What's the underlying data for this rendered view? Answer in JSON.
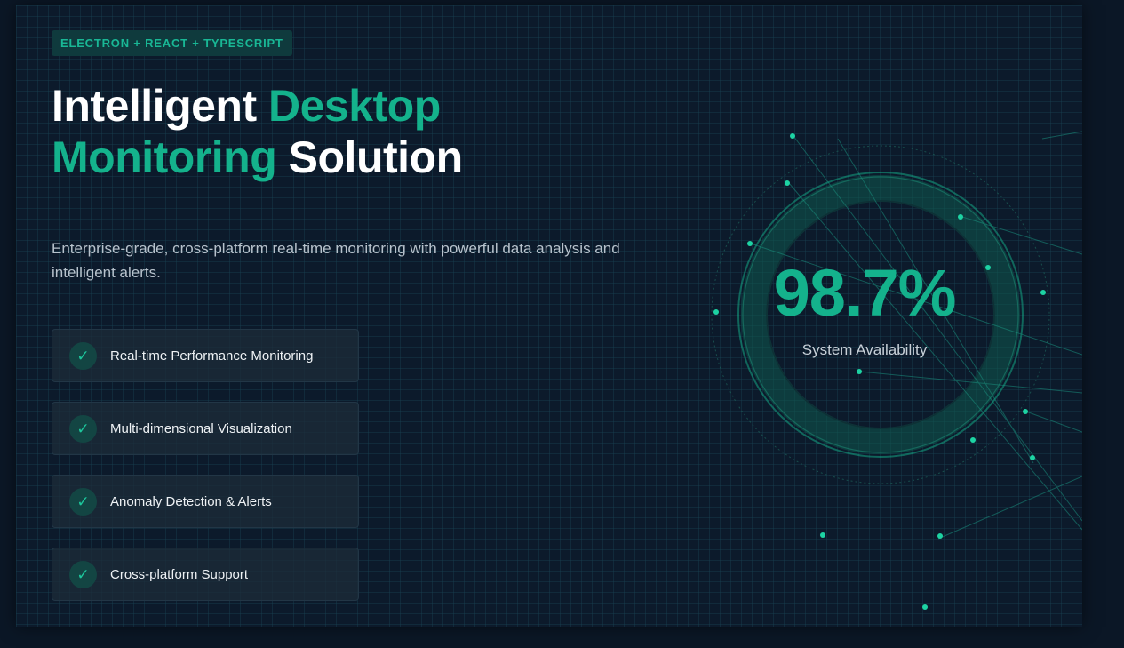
{
  "hero": {
    "badge": "ELECTRON + REACT + TYPESCRIPT",
    "title_part1": "Intelligent ",
    "title_part2": "Desktop",
    "title_part3": "Monitoring",
    "title_part4": " Solution",
    "subtitle": "Enterprise-grade, cross-platform real-time monitoring with powerful data analysis and intelligent alerts."
  },
  "features": [
    {
      "label": "Real-time Performance Monitoring",
      "icon": "check-icon"
    },
    {
      "label": "Multi-dimensional Visualization",
      "icon": "check-icon"
    },
    {
      "label": "Anomaly Detection & Alerts",
      "icon": "check-icon"
    },
    {
      "label": "Cross-platform Support",
      "icon": "check-icon"
    }
  ],
  "stat": {
    "value": "98.7%",
    "label": "System Availability"
  },
  "colors": {
    "accent": "#14b28c",
    "background": "#0c1a2b",
    "text": "#ffffff"
  }
}
